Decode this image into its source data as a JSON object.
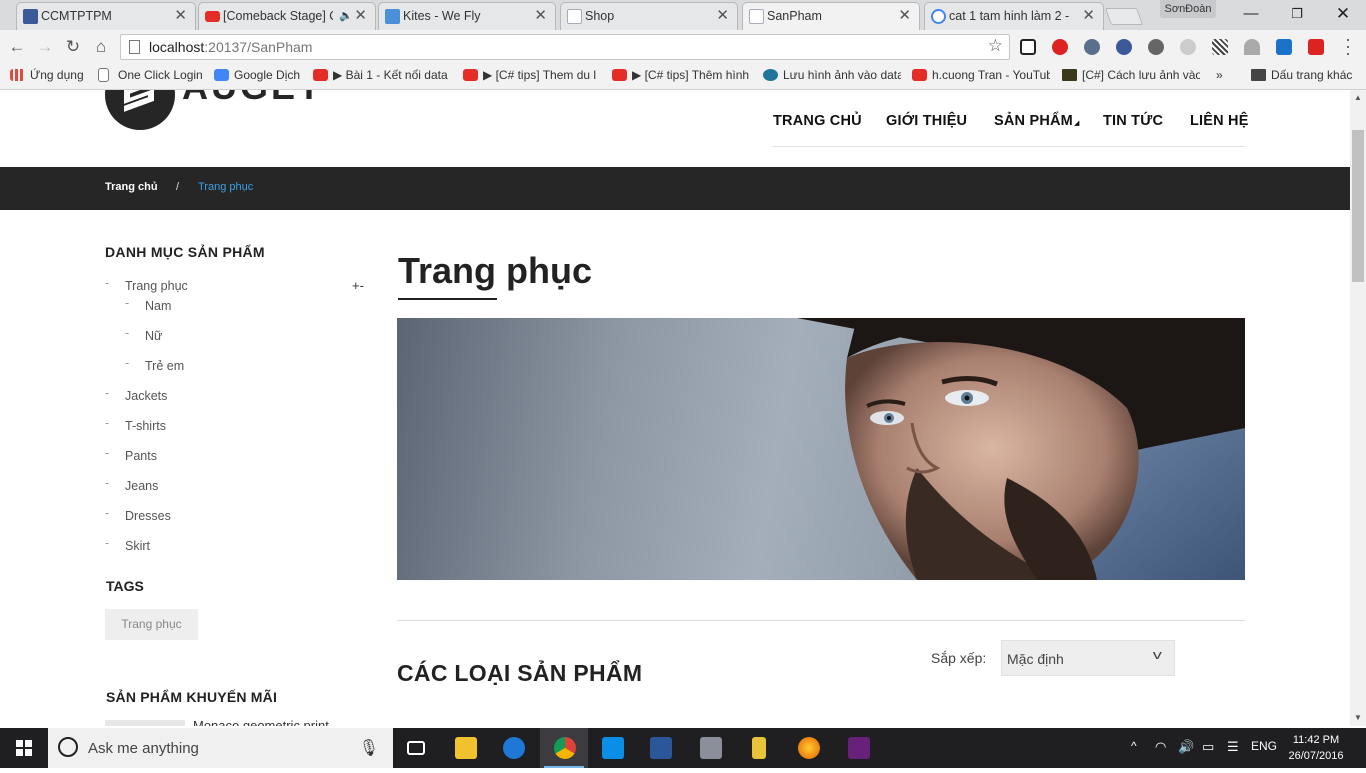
{
  "browser": {
    "tabs": [
      {
        "title": "CCMTPTPM",
        "favicon_color": "#3b5998"
      },
      {
        "title": "[Comeback Stage] C",
        "favicon_color": "#e52d27",
        "audio": "🔈"
      },
      {
        "title": "Kites - We Fly",
        "favicon_color": "#4a90d9"
      },
      {
        "title": "Shop",
        "favicon_color": "#cfd8e3"
      },
      {
        "title": "SanPham",
        "favicon_color": "#cfd8e3"
      },
      {
        "title": "cat 1 tam hinh làm 2 -",
        "favicon_color": "#4285f4"
      }
    ],
    "profile_name": "SơnĐoàn",
    "url_host": "localhost",
    "url_path": ":20137/SanPham",
    "bookmarks": [
      {
        "label": "Ứng dụng",
        "color": "#e04a3f"
      },
      {
        "label": "One Click Login",
        "color": "#ffffff"
      },
      {
        "label": "Google Dịch",
        "color": "#4285f4"
      },
      {
        "label": "▶ Bài 1 - Kết nối data",
        "color": "#e52d27"
      },
      {
        "label": "▶ [C# tips] Them du l",
        "color": "#e52d27"
      },
      {
        "label": "▶ [C# tips] Thêm hình",
        "color": "#e52d27"
      },
      {
        "label": "Lưu hình ảnh vào data",
        "color": "#21759b"
      },
      {
        "label": "h.cuong Tran - YouTub",
        "color": "#e52d27"
      },
      {
        "label": "[C#] Cách lưu ảnh vào",
        "color": "#3a3a1a"
      },
      {
        "label": "»",
        "color": "#f2f2f2"
      },
      {
        "label": "Dấu trang khác",
        "color": "#444444"
      }
    ]
  },
  "site": {
    "logo_text": "AUGET",
    "nav": [
      "TRANG CHỦ",
      "GIỚI THIỆU",
      "SẢN PHẨM",
      "TIN TỨC",
      "LIÊN HỆ"
    ],
    "breadcrumb": {
      "home": "Trang chủ",
      "separator": "/",
      "current": "Trang phục"
    },
    "sidebar": {
      "title": "DANH MỤC SẢN PHẨM",
      "toggle": "+-",
      "categories": [
        "Trang phục",
        "Jackets",
        "T-shirts",
        "Pants",
        "Jeans",
        "Dresses",
        "Skirt"
      ],
      "subcategories": [
        "Nam",
        "Nữ",
        "Trẻ em"
      ],
      "tags_title": "TAGS",
      "tag": "Trang phục",
      "promo_title": "SẢN PHẨM KHUYẾN MÃI",
      "promo_item": "Monaco geometric print"
    },
    "page_title": "Trang phục",
    "section_title": "CÁC LOẠI SẢN PHẨM",
    "sort": {
      "label": "Sắp xếp:",
      "value": "Mặc định"
    }
  },
  "taskbar": {
    "search_placeholder": "Ask me anything",
    "language": "ENG",
    "time": "11:42 PM",
    "date": "26/07/2016"
  }
}
